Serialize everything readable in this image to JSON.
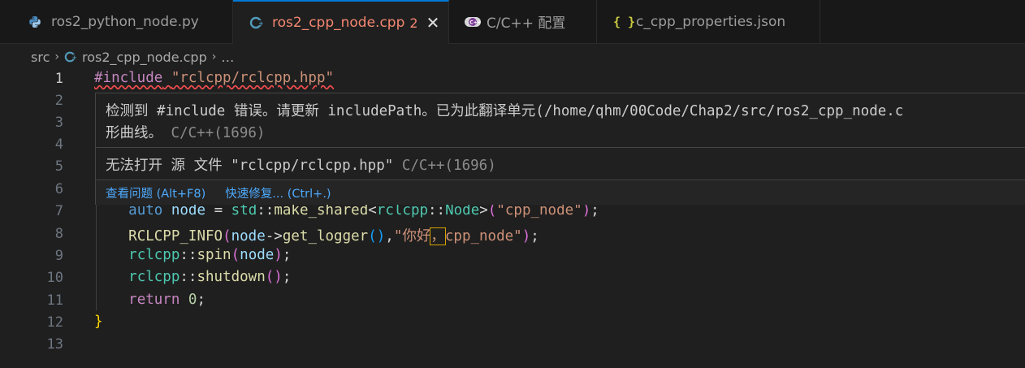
{
  "tabs": [
    {
      "label": "ros2_python_node.py",
      "icon": "python-icon",
      "active": false,
      "badge": "",
      "error": false
    },
    {
      "label": "ros2_cpp_node.cpp",
      "icon": "cpp-icon",
      "active": true,
      "badge": "2",
      "error": true
    },
    {
      "label": "C/C++ 配置",
      "icon": "cpp-config-icon",
      "active": false,
      "badge": "",
      "error": false
    },
    {
      "label": "c_cpp_properties.json",
      "icon": "json-icon",
      "active": false,
      "badge": "",
      "error": false
    }
  ],
  "tab_close_glyph": "✕",
  "json_icon_glyph": "{ }",
  "breadcrumb": {
    "folder": "src",
    "file": "ros2_cpp_node.cpp",
    "more": "…"
  },
  "line_numbers": [
    "1",
    "2",
    "3",
    "4",
    "5",
    "6",
    "7",
    "8",
    "9",
    "10",
    "11",
    "12",
    "13"
  ],
  "code": {
    "line1": {
      "directive": "#include",
      "header": "\"rclcpp/rclcpp.hpp\""
    },
    "line7": {
      "kw": "auto",
      "var": "node",
      "eq": "=",
      "ns": "std",
      "sep": "::",
      "fn": "make_shared",
      "lt": "<",
      "ns2": "rclcpp",
      "cls": "Node",
      "gt": ">",
      "arg": "\"cpp_node\"",
      "end": ";"
    },
    "line8": {
      "fn": "RCLCPP_INFO",
      "var": "node",
      "arrow": "->",
      "fn2": "get_logger",
      "comma": ",",
      "str_a": "\"你好",
      "str_b": "，",
      "str_c": "cpp_node\"",
      "end": ";"
    },
    "line9": {
      "ns": "rclcpp",
      "sep": "::",
      "fn": "spin",
      "var": "node",
      "end": ";"
    },
    "line10": {
      "ns": "rclcpp",
      "sep": "::",
      "fn": "shutdown",
      "end": ";"
    },
    "line11": {
      "kw": "return",
      "num": "0",
      "end": ";"
    },
    "line12": {
      "brace": "}"
    }
  },
  "hover": {
    "msg1_line1": "检测到 #include 错误。请更新 includePath。已为此翻译单元(/home/qhm/00Code/Chap2/src/ros2_cpp_node.c",
    "msg1_line2": "形曲线。",
    "msg1_source": "C/C++(1696)",
    "msg2": "无法打开 源 文件 \"rclcpp/rclcpp.hpp\"",
    "msg2_source": "C/C++(1696)",
    "action_view_problem": "查看问题 (Alt+F8)",
    "action_quick_fix": "快速修复... (Ctrl+.)"
  },
  "colors": {
    "accent": "#0078d4",
    "error": "#f48771",
    "link": "#4daafc",
    "background": "#1f1f1f"
  }
}
